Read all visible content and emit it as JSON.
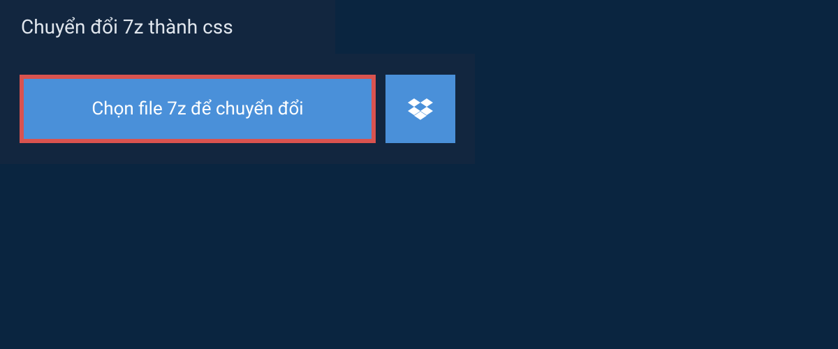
{
  "header": {
    "title": "Chuyển đổi 7z thành css"
  },
  "upload": {
    "choose_file_label": "Chọn file 7z để chuyển đổi",
    "dropbox_icon_name": "dropbox-icon"
  },
  "colors": {
    "background": "#0a2540",
    "panel": "#12263f",
    "button": "#4a90d9",
    "highlight_border": "#d9534f",
    "text_light": "#e0e6ed",
    "text_white": "#ffffff"
  }
}
